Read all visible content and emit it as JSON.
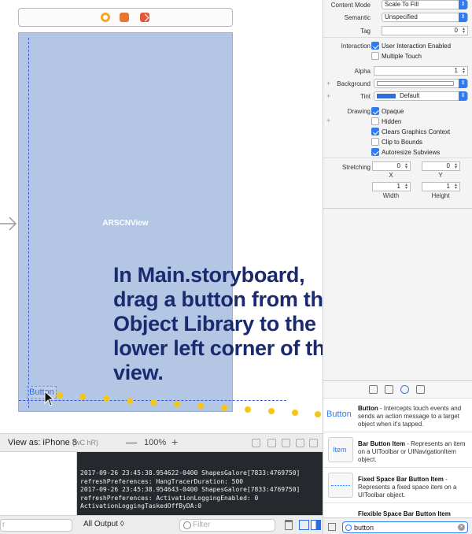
{
  "canvas": {
    "view_label": "ARSCNView",
    "dragged_button_label": "Button",
    "tutorial_text": "In Main.storyboard, drag a button from the Object Library to the lower left corner of the view.",
    "accent_color": "#f5c518"
  },
  "viewas": {
    "label": "View as: iPhone 8",
    "shortcut": "(wC hR)",
    "zoom_minus": "—",
    "zoom_level": "100%",
    "zoom_plus": "+"
  },
  "console": {
    "lines": [
      "2017-09-26 23:45:38.954622-0400 ShapesGalore[7833:4769750]",
      "refreshPreferences: HangTracerDuration: 500",
      "2017-09-26 23:45:38.954643-0400 ShapesGalore[7833:4769750]",
      "refreshPreferences: ActivationLoggingEnabled: 0",
      "ActivationLoggingTaskedOffByDA:0"
    ]
  },
  "bottom_bar": {
    "filter_left_placeholder": "r",
    "output_select": "All Output ◊",
    "filter_right_placeholder": "Filter"
  },
  "inspector": {
    "content_mode": {
      "label": "Content Mode",
      "value": "Scale To Fill"
    },
    "semantic": {
      "label": "Semantic",
      "value": "Unspecified"
    },
    "tag": {
      "label": "Tag",
      "value": "0"
    },
    "interaction": {
      "label": "Interaction",
      "user_interaction": "User Interaction Enabled",
      "multiple_touch": "Multiple Touch"
    },
    "alpha": {
      "label": "Alpha",
      "value": "1"
    },
    "background": {
      "label": "Background"
    },
    "tint": {
      "label": "Tint",
      "value": "Default",
      "swatch_color": "#2f6fd8"
    },
    "drawing": {
      "label": "Drawing",
      "opaque": "Opaque",
      "hidden": "Hidden",
      "clears": "Clears Graphics Context",
      "clip": "Clip to Bounds",
      "autoresize": "Autoresize Subviews"
    },
    "stretching": {
      "label": "Stretching",
      "x": "0",
      "y": "0",
      "x_label": "X",
      "y_label": "Y",
      "width": "1",
      "height": "1",
      "width_label": "Width",
      "height_label": "Height"
    }
  },
  "library": {
    "items": [
      {
        "thumb": "Button",
        "name": "Button",
        "desc": " - Intercepts touch events and sends an action message to a target object when it's tapped."
      },
      {
        "thumb": "Item",
        "name": "Bar Button Item",
        "desc": " - Represents an item on a UIToolbar or UINavigationItem object."
      },
      {
        "thumb": "",
        "name": "Fixed Space Bar Button Item",
        "desc": " - Represents a fixed space item on a UIToolbar object."
      },
      {
        "thumb": "",
        "name": "Flexible Space Bar Button Item",
        "desc": ""
      }
    ],
    "search_value": "button"
  }
}
